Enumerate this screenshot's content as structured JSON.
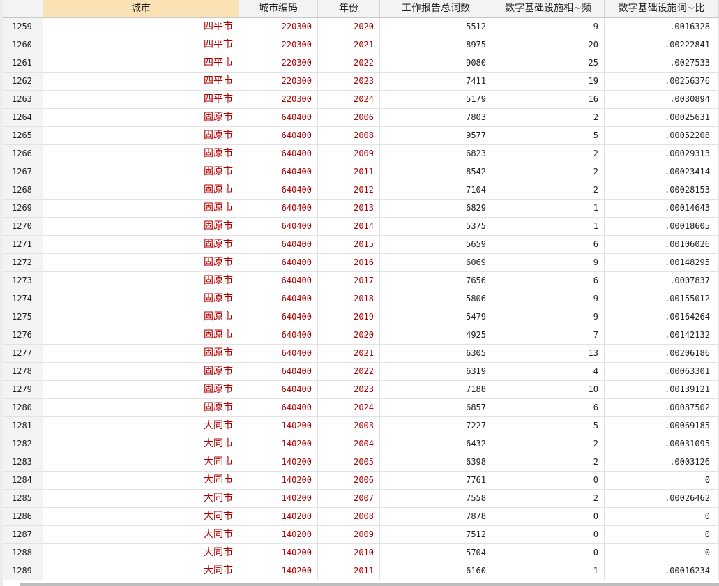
{
  "columns": {
    "city": "城市",
    "code": "城市编码",
    "year": "年份",
    "total": "工作报告总词数",
    "freq": "数字基础设施相~频",
    "ratio": "数字基础设施词~比"
  },
  "rows": [
    {
      "idx": "1259",
      "city": "四平市",
      "code": "220300",
      "year": "2020",
      "total": "5512",
      "freq": "9",
      "ratio": ".0016328"
    },
    {
      "idx": "1260",
      "city": "四平市",
      "code": "220300",
      "year": "2021",
      "total": "8975",
      "freq": "20",
      "ratio": ".00222841"
    },
    {
      "idx": "1261",
      "city": "四平市",
      "code": "220300",
      "year": "2022",
      "total": "9080",
      "freq": "25",
      "ratio": ".0027533"
    },
    {
      "idx": "1262",
      "city": "四平市",
      "code": "220300",
      "year": "2023",
      "total": "7411",
      "freq": "19",
      "ratio": ".00256376"
    },
    {
      "idx": "1263",
      "city": "四平市",
      "code": "220300",
      "year": "2024",
      "total": "5179",
      "freq": "16",
      "ratio": ".0030894"
    },
    {
      "idx": "1264",
      "city": "固原市",
      "code": "640400",
      "year": "2006",
      "total": "7803",
      "freq": "2",
      "ratio": ".00025631"
    },
    {
      "idx": "1265",
      "city": "固原市",
      "code": "640400",
      "year": "2008",
      "total": "9577",
      "freq": "5",
      "ratio": ".00052208"
    },
    {
      "idx": "1266",
      "city": "固原市",
      "code": "640400",
      "year": "2009",
      "total": "6823",
      "freq": "2",
      "ratio": ".00029313"
    },
    {
      "idx": "1267",
      "city": "固原市",
      "code": "640400",
      "year": "2011",
      "total": "8542",
      "freq": "2",
      "ratio": ".00023414"
    },
    {
      "idx": "1268",
      "city": "固原市",
      "code": "640400",
      "year": "2012",
      "total": "7104",
      "freq": "2",
      "ratio": ".00028153"
    },
    {
      "idx": "1269",
      "city": "固原市",
      "code": "640400",
      "year": "2013",
      "total": "6829",
      "freq": "1",
      "ratio": ".00014643"
    },
    {
      "idx": "1270",
      "city": "固原市",
      "code": "640400",
      "year": "2014",
      "total": "5375",
      "freq": "1",
      "ratio": ".00018605"
    },
    {
      "idx": "1271",
      "city": "固原市",
      "code": "640400",
      "year": "2015",
      "total": "5659",
      "freq": "6",
      "ratio": ".00106026"
    },
    {
      "idx": "1272",
      "city": "固原市",
      "code": "640400",
      "year": "2016",
      "total": "6069",
      "freq": "9",
      "ratio": ".00148295"
    },
    {
      "idx": "1273",
      "city": "固原市",
      "code": "640400",
      "year": "2017",
      "total": "7656",
      "freq": "6",
      "ratio": ".0007837"
    },
    {
      "idx": "1274",
      "city": "固原市",
      "code": "640400",
      "year": "2018",
      "total": "5806",
      "freq": "9",
      "ratio": ".00155012"
    },
    {
      "idx": "1275",
      "city": "固原市",
      "code": "640400",
      "year": "2019",
      "total": "5479",
      "freq": "9",
      "ratio": ".00164264"
    },
    {
      "idx": "1276",
      "city": "固原市",
      "code": "640400",
      "year": "2020",
      "total": "4925",
      "freq": "7",
      "ratio": ".00142132"
    },
    {
      "idx": "1277",
      "city": "固原市",
      "code": "640400",
      "year": "2021",
      "total": "6305",
      "freq": "13",
      "ratio": ".00206186"
    },
    {
      "idx": "1278",
      "city": "固原市",
      "code": "640400",
      "year": "2022",
      "total": "6319",
      "freq": "4",
      "ratio": ".00063301"
    },
    {
      "idx": "1279",
      "city": "固原市",
      "code": "640400",
      "year": "2023",
      "total": "7188",
      "freq": "10",
      "ratio": ".00139121"
    },
    {
      "idx": "1280",
      "city": "固原市",
      "code": "640400",
      "year": "2024",
      "total": "6857",
      "freq": "6",
      "ratio": ".00087502"
    },
    {
      "idx": "1281",
      "city": "大同市",
      "code": "140200",
      "year": "2003",
      "total": "7227",
      "freq": "5",
      "ratio": ".00069185"
    },
    {
      "idx": "1282",
      "city": "大同市",
      "code": "140200",
      "year": "2004",
      "total": "6432",
      "freq": "2",
      "ratio": ".00031095"
    },
    {
      "idx": "1283",
      "city": "大同市",
      "code": "140200",
      "year": "2005",
      "total": "6398",
      "freq": "2",
      "ratio": ".0003126"
    },
    {
      "idx": "1284",
      "city": "大同市",
      "code": "140200",
      "year": "2006",
      "total": "7761",
      "freq": "0",
      "ratio": "0"
    },
    {
      "idx": "1285",
      "city": "大同市",
      "code": "140200",
      "year": "2007",
      "total": "7558",
      "freq": "2",
      "ratio": ".00026462"
    },
    {
      "idx": "1286",
      "city": "大同市",
      "code": "140200",
      "year": "2008",
      "total": "7878",
      "freq": "0",
      "ratio": "0"
    },
    {
      "idx": "1287",
      "city": "大同市",
      "code": "140200",
      "year": "2009",
      "total": "7512",
      "freq": "0",
      "ratio": "0"
    },
    {
      "idx": "1288",
      "city": "大同市",
      "code": "140200",
      "year": "2010",
      "total": "5704",
      "freq": "0",
      "ratio": "0"
    },
    {
      "idx": "1289",
      "city": "大同市",
      "code": "140200",
      "year": "2011",
      "total": "6160",
      "freq": "1",
      "ratio": ".00016234"
    }
  ]
}
